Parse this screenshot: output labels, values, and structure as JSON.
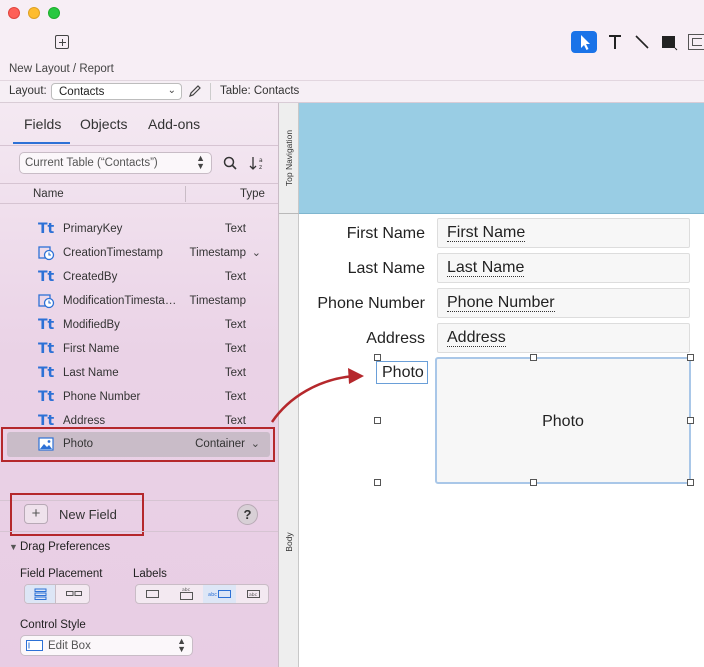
{
  "window": {
    "toolbar_label": "New Layout / Report"
  },
  "layout_bar": {
    "layout_label": "Layout:",
    "layout_value": "Contacts",
    "table_label": "Table: Contacts"
  },
  "panel": {
    "tabs": [
      "Fields",
      "Objects",
      "Add-ons"
    ],
    "active_tab": "Fields",
    "table_selector": "Current Table (“Contacts”)",
    "col_name": "Name",
    "col_type": "Type",
    "fields": [
      {
        "name": "PrimaryKey",
        "type": "Text",
        "icon": "text-field-icon"
      },
      {
        "name": "CreationTimestamp",
        "type": "Timestamp",
        "icon": "timestamp-field-icon"
      },
      {
        "name": "CreatedBy",
        "type": "Text",
        "icon": "text-field-icon"
      },
      {
        "name": "ModificationTimesta…",
        "type": "Timestamp",
        "icon": "timestamp-field-icon"
      },
      {
        "name": "ModifiedBy",
        "type": "Text",
        "icon": "text-field-icon"
      },
      {
        "name": "First Name",
        "type": "Text",
        "icon": "text-field-icon"
      },
      {
        "name": "Last Name",
        "type": "Text",
        "icon": "text-field-icon"
      },
      {
        "name": "Phone Number",
        "type": "Text",
        "icon": "text-field-icon"
      },
      {
        "name": "Address",
        "type": "Text",
        "icon": "text-field-icon"
      },
      {
        "name": "Photo",
        "type": "Container",
        "icon": "container-field-icon"
      }
    ],
    "new_field_label": "New Field",
    "help_label": "?",
    "drag_prefs_label": "Drag Preferences",
    "field_placement_label": "Field Placement",
    "labels_label": "Labels",
    "control_style_label": "Control Style",
    "control_style_value": "Edit Box"
  },
  "parts": {
    "top_nav": "Top Navigation",
    "body": "Body"
  },
  "canvas": {
    "fields": [
      {
        "label": "First Name",
        "value": "First Name"
      },
      {
        "label": "Last Name",
        "value": "Last Name"
      },
      {
        "label": "Phone Number",
        "value": "Phone Number"
      },
      {
        "label": "Address",
        "value": "Address"
      }
    ],
    "photo_label": "Photo",
    "photo_box": "Photo"
  },
  "colors": {
    "accent": "#2d71d6",
    "highlight_border": "#b5282c",
    "top_nav_bg": "#99cde4",
    "selection_border": "#8fb6e2"
  }
}
